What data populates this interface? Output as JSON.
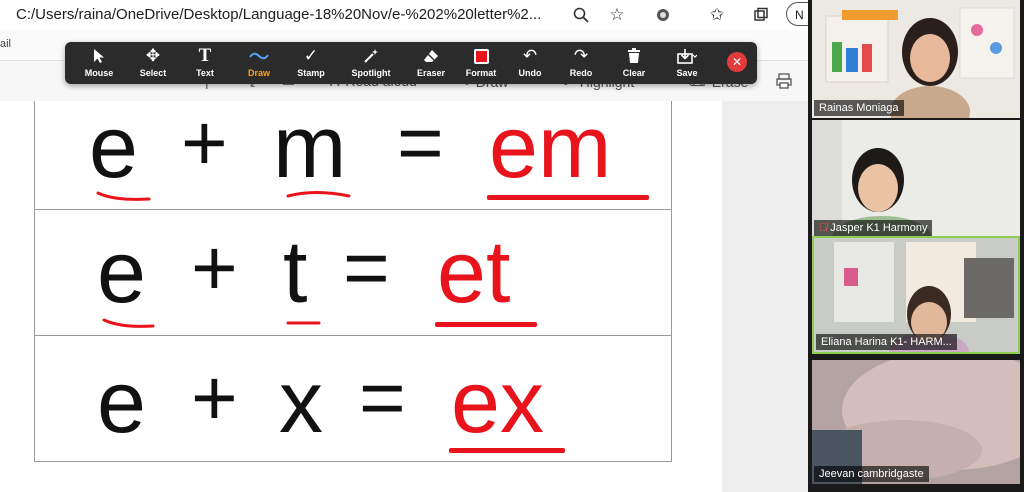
{
  "browser": {
    "url": "C:/Users/raina/OneDrive/Desktop/Language-18%20Nov/e-%202%20letter%2...",
    "profile_label": "N",
    "favorites_text": "ail",
    "reader": {
      "read_aloud": "Read aloud",
      "draw": "Draw",
      "highlight": "Highlight",
      "erase": "Erase"
    }
  },
  "toolbar": {
    "mouse": "Mouse",
    "select": "Select",
    "text": "Text",
    "draw": "Draw",
    "stamp": "Stamp",
    "spotlight": "Spotlight",
    "eraser": "Eraser",
    "format": "Format",
    "undo": "Undo",
    "redo": "Redo",
    "clear": "Clear",
    "save": "Save",
    "format_color": "#e8131b",
    "active_color": "#f7a31b"
  },
  "document": {
    "rows": [
      {
        "a": "e",
        "op": "+",
        "b": "m",
        "eq": "=",
        "result": "em"
      },
      {
        "a": "e",
        "op": "+",
        "b": "t",
        "eq": "=",
        "result": "et"
      },
      {
        "a": "e",
        "op": "+",
        "b": "x",
        "eq": "=",
        "result": "ex"
      }
    ],
    "accent_color": "#e8131b"
  },
  "participants": [
    {
      "name": "Rainas Moniaga",
      "muted": false,
      "speaking": false
    },
    {
      "name": "Jasper K1 Harmony",
      "muted": true,
      "speaking": false
    },
    {
      "name": "Eliana Harina K1- HARM...",
      "muted": false,
      "speaking": true
    },
    {
      "name": "Jeevan cambridgaste",
      "muted": false,
      "speaking": false
    }
  ]
}
